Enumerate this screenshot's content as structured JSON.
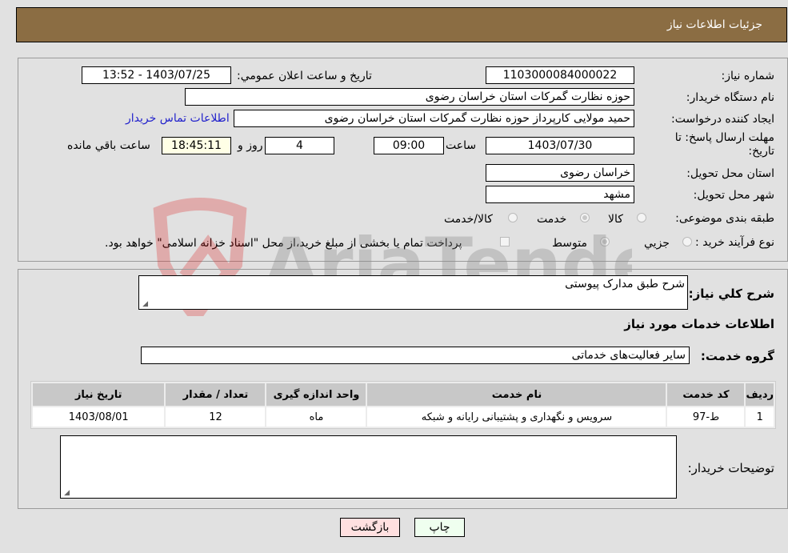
{
  "header": {
    "title": "جزئیات اطلاعات نیاز"
  },
  "form": {
    "need_number": {
      "label": "شماره نیاز:",
      "value": "1103000084000022"
    },
    "announce_datetime": {
      "label": "تاريخ و ساعت اعلان عمومي:",
      "value": "1403/07/25 - 13:52"
    },
    "buyer_org": {
      "label": "نام دستگاه خريدار:",
      "value": "حوزه نظارت گمرکات استان خراسان رضوی"
    },
    "requester": {
      "label": "ايجاد کننده درخواست:",
      "value": "حمید مولایی کارپرداز حوزه نظارت گمرکات استان خراسان رضوی"
    },
    "contact_link": "اطلاعات تماس خريدار",
    "deadline": {
      "label_line1": "مهلت ارسال پاسخ: تا",
      "label_line2": "تاريخ:",
      "date": "1403/07/30",
      "time_label": "ساعت",
      "time": "09:00",
      "days": "4",
      "days_label": "روز و",
      "remaining": "18:45:11",
      "remaining_label": "ساعت باقي مانده"
    },
    "delivery_province": {
      "label": "استان محل تحويل:",
      "value": "خراسان رضوی"
    },
    "delivery_city": {
      "label": "شهر محل تحويل:",
      "value": "مشهد"
    },
    "category": {
      "label": "طبقه بندی موضوعی:",
      "options": [
        "کالا",
        "خدمت",
        "کالا/خدمت"
      ],
      "selected": "خدمت"
    },
    "purchase_process": {
      "label": "نوع فرآيند خريد :",
      "options": [
        "جزيي",
        "متوسط"
      ],
      "selected": "متوسط",
      "treasury_checkbox_label": "پرداخت تمام یا بخشی از مبلغ خرید،از محل \"اسناد خزانه اسلامی\" خواهد بود.",
      "treasury_checked": false
    }
  },
  "details": {
    "description": {
      "label": "شرح کلي نياز:",
      "value": "شرح طبق مدارک پیوستی"
    },
    "services_heading": "اطلاعات خدمات مورد نياز",
    "service_group": {
      "label": "گروه خدمت:",
      "value": "سایر فعالیت‌های خدماتی"
    },
    "table": {
      "headers": [
        "رديف",
        "کد خدمت",
        "نام خدمت",
        "واحد اندازه گيری",
        "تعداد / مقدار",
        "تاريخ نياز"
      ],
      "rows": [
        [
          "1",
          "ط-97",
          "سرویس و نگهداری و پشتیبانی رایانه و شبکه",
          "ماه",
          "12",
          "1403/08/01"
        ]
      ]
    },
    "buyer_notes": {
      "label": "توضيحات خريدار:",
      "value": ""
    }
  },
  "buttons": {
    "print": "چاپ",
    "back": "بازگشت"
  },
  "watermark": {
    "text": "AriaTender.neT"
  },
  "colors": {
    "header_bg": "#8b6d43",
    "print_bg": "#efffef",
    "back_bg": "#ffe0e0",
    "link": "#2222cc"
  }
}
